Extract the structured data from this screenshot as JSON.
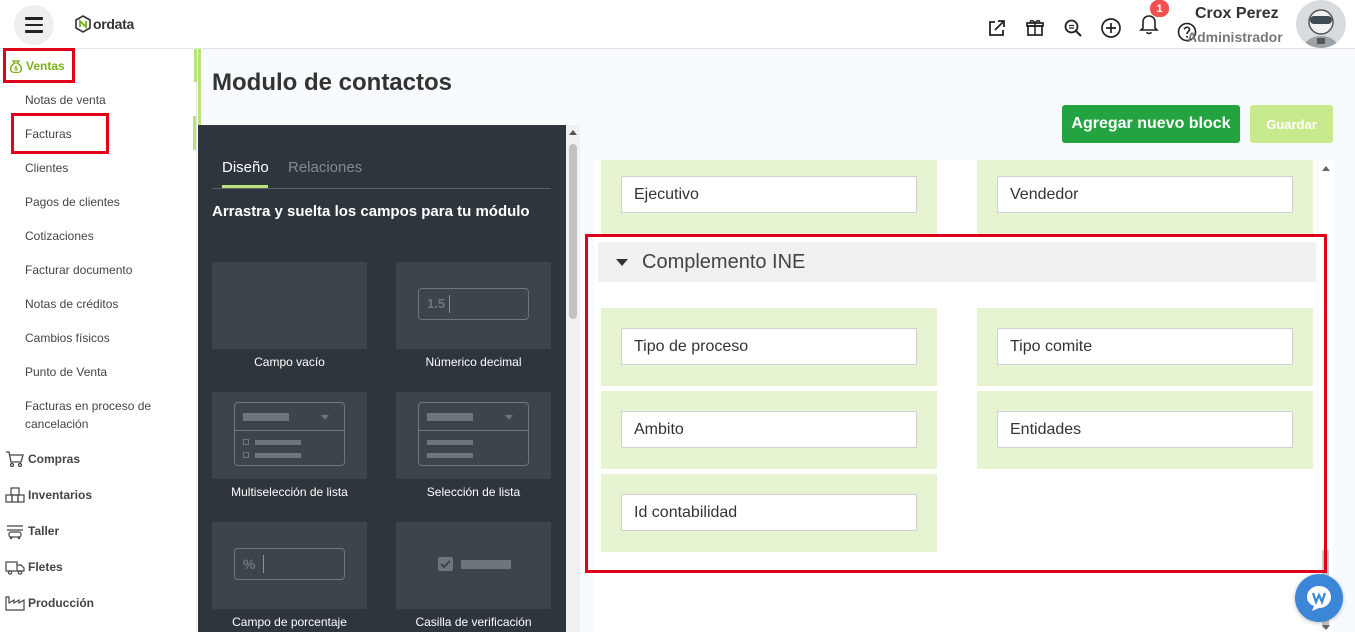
{
  "app": {
    "logo_text": "ordata"
  },
  "header": {
    "notification_count": "1",
    "user_name": "Crox Perez",
    "user_role": "Administrador"
  },
  "sidebar": {
    "section": "Ventas",
    "items": [
      "Notas de venta",
      "Facturas",
      "Clientes",
      "Pagos de clientes",
      "Cotizaciones",
      "Facturar documento",
      "Notas de créditos",
      "Cambios físicos",
      "Punto de Venta",
      "Facturas en proceso de cancelación"
    ],
    "groups": [
      "Compras",
      "Inventarios",
      "Taller",
      "Fletes",
      "Producción"
    ]
  },
  "page": {
    "title": "Modulo de contactos"
  },
  "toolbar": {
    "add_block": "Agregar nuevo block",
    "save": "Guardar"
  },
  "panel": {
    "tabs": [
      "Diseño",
      "Relaciones"
    ],
    "heading": "Arrastra y suelta los campos para tu módulo",
    "tiles": [
      "Campo vacío",
      "Númerico decimal",
      "Multiselección de lista",
      "Selección de lista",
      "Campo de porcentaje",
      "Casilla de verificación"
    ],
    "decimal_sample": "1.5",
    "percent_sample": "%"
  },
  "canvas": {
    "top_fields": [
      "Ejecutivo",
      "Vendedor"
    ],
    "block_title": "Complemento INE",
    "block_fields": [
      "Tipo de proceso",
      "Tipo comite",
      "Ambito",
      "Entidades",
      "Id contabilidad"
    ]
  },
  "colors": {
    "brand_green": "#7ab317",
    "add_button": "#23a440",
    "save_button": "#c8ea8c",
    "highlight": "#e1001a",
    "field_cell": "#e6f4d1",
    "panel_bg": "#2e353d"
  },
  "icons": [
    "menu-icon",
    "external-link-icon",
    "gift-icon",
    "search-zoom-icon",
    "plus-circle-icon",
    "bell-icon",
    "help-icon",
    "chat-icon"
  ]
}
